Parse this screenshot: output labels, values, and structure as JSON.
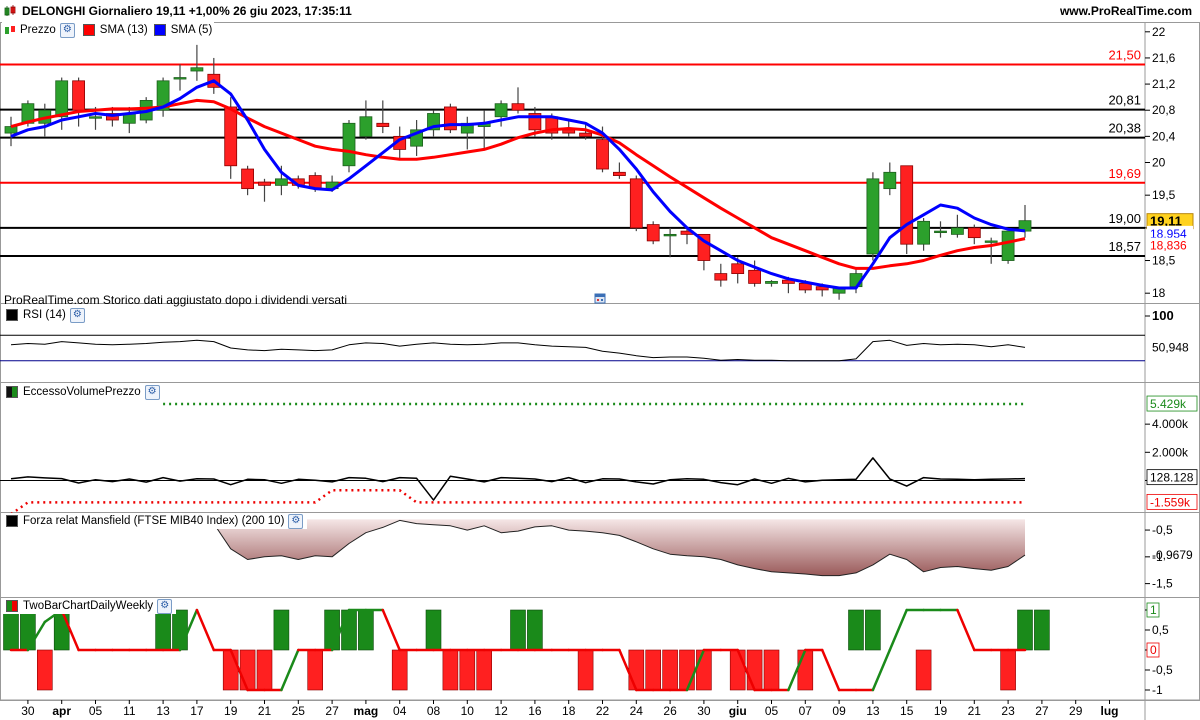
{
  "header": {
    "title": "DELONGHI Giornaliero 19,11 +1,00% 26 giu 2023, 17:35:11",
    "site": "www.ProRealTime.com"
  },
  "legends": {
    "price": [
      {
        "label": "Prezzo",
        "color": "#2ca02c"
      },
      {
        "label": "SMA (13)",
        "color": "#ff0000"
      },
      {
        "label": "SMA (5)",
        "color": "#0000ff"
      }
    ],
    "rsi": "RSI (14)",
    "eccesso": "EccessoVolumePrezzo",
    "forza": "Forza relat Mansfield (FTSE MIB40 Index) (200 10)",
    "twobar": "TwoBarChartDailyWeekly"
  },
  "note": "ProRealTime.com  Storico dati aggiustato dopo i dividendi versati",
  "chart_data": {
    "type": "candlestick",
    "x": [
      "29 mar",
      "30 mar",
      "31 mar",
      "03 apr",
      "04 apr",
      "05 apr",
      "06 apr",
      "11 apr",
      "12 apr",
      "13 apr",
      "14 apr",
      "17 apr",
      "18 apr",
      "19 apr",
      "20 apr",
      "21 apr",
      "24 apr",
      "25 apr",
      "26 apr",
      "27 apr",
      "28 apr",
      "02 mag",
      "03 mag",
      "04 mag",
      "05 mag",
      "08 mag",
      "09 mag",
      "10 mag",
      "11 mag",
      "12 mag",
      "15 mag",
      "16 mag",
      "17 mag",
      "18 mag",
      "19 mag",
      "22 mag",
      "23 mag",
      "24 mag",
      "25 mag",
      "26 mag",
      "29 mag",
      "30 mag",
      "31 mag",
      "01 giu",
      "02 giu",
      "05 giu",
      "06 giu",
      "07 giu",
      "08 giu",
      "09 giu",
      "12 giu",
      "13 giu",
      "14 giu",
      "15 giu",
      "16 giu",
      "19 giu",
      "20 giu",
      "21 giu",
      "22 giu",
      "23 giu",
      "26 giu"
    ],
    "x_ticks": [
      "30",
      "apr",
      "05",
      "11",
      "13",
      "17",
      "19",
      "21",
      "25",
      "27",
      "mag",
      "04",
      "08",
      "10",
      "12",
      "16",
      "18",
      "22",
      "24",
      "26",
      "30",
      "giu",
      "05",
      "07",
      "09",
      "13",
      "15",
      "19",
      "21",
      "23",
      "27",
      "29",
      "lug"
    ],
    "price": {
      "ylim": [
        17.85,
        22.15
      ],
      "y_ticks": [
        "22",
        "21,6",
        "21,2",
        "20,8",
        "20,4",
        "20",
        "19,5",
        "19",
        "18,5",
        "18"
      ],
      "ohlc": [
        [
          20.45,
          20.7,
          20.25,
          20.55
        ],
        [
          20.6,
          20.95,
          20.55,
          20.9
        ],
        [
          20.6,
          20.9,
          20.4,
          20.8
        ],
        [
          20.7,
          21.3,
          20.5,
          21.25
        ],
        [
          21.25,
          21.3,
          20.55,
          20.8
        ],
        [
          20.7,
          20.85,
          20.5,
          20.7
        ],
        [
          20.75,
          20.85,
          20.55,
          20.65
        ],
        [
          20.6,
          20.85,
          20.45,
          20.75
        ],
        [
          20.65,
          21.0,
          20.6,
          20.95
        ],
        [
          20.8,
          21.3,
          20.7,
          21.25
        ],
        [
          21.3,
          21.5,
          21.1,
          21.3
        ],
        [
          21.4,
          21.8,
          21.25,
          21.45
        ],
        [
          21.35,
          21.6,
          21.05,
          21.15
        ],
        [
          20.85,
          21.0,
          19.75,
          19.95
        ],
        [
          19.9,
          19.95,
          19.5,
          19.6
        ],
        [
          19.7,
          19.75,
          19.4,
          19.65
        ],
        [
          19.65,
          19.95,
          19.5,
          19.75
        ],
        [
          19.75,
          19.8,
          19.6,
          19.65
        ],
        [
          19.8,
          19.85,
          19.55,
          19.6
        ],
        [
          19.6,
          19.8,
          19.55,
          19.7
        ],
        [
          19.95,
          20.65,
          19.85,
          20.6
        ],
        [
          20.4,
          20.95,
          20.35,
          20.7
        ],
        [
          20.6,
          20.95,
          20.45,
          20.55
        ],
        [
          20.4,
          20.55,
          20.05,
          20.2
        ],
        [
          20.25,
          20.65,
          20.1,
          20.5
        ],
        [
          20.5,
          20.8,
          20.4,
          20.75
        ],
        [
          20.85,
          20.9,
          20.45,
          20.5
        ],
        [
          20.45,
          20.7,
          20.2,
          20.6
        ],
        [
          20.55,
          20.8,
          20.2,
          20.6
        ],
        [
          20.7,
          20.95,
          20.55,
          20.9
        ],
        [
          20.9,
          21.15,
          20.75,
          20.8
        ],
        [
          20.75,
          20.85,
          20.4,
          20.5
        ],
        [
          20.7,
          20.75,
          20.35,
          20.45
        ],
        [
          20.5,
          20.65,
          20.4,
          20.45
        ],
        [
          20.45,
          20.6,
          20.35,
          20.4
        ],
        [
          20.35,
          20.55,
          19.85,
          19.9
        ],
        [
          19.85,
          20.0,
          19.75,
          19.8
        ],
        [
          19.75,
          19.8,
          18.95,
          19.0
        ],
        [
          19.05,
          19.1,
          18.75,
          18.8
        ],
        [
          18.9,
          19.0,
          18.55,
          18.9
        ],
        [
          18.95,
          19.0,
          18.75,
          18.9
        ],
        [
          18.9,
          18.9,
          18.35,
          18.5
        ],
        [
          18.3,
          18.45,
          18.1,
          18.2
        ],
        [
          18.45,
          18.55,
          18.15,
          18.3
        ],
        [
          18.35,
          18.5,
          18.1,
          18.15
        ],
        [
          18.15,
          18.2,
          18.1,
          18.18
        ],
        [
          18.2,
          18.25,
          18.0,
          18.15
        ],
        [
          18.15,
          18.2,
          18.0,
          18.05
        ],
        [
          18.1,
          18.15,
          17.95,
          18.05
        ],
        [
          18.0,
          18.1,
          17.9,
          18.08
        ],
        [
          18.1,
          18.4,
          18.0,
          18.3
        ],
        [
          18.6,
          19.85,
          18.5,
          19.75
        ],
        [
          19.6,
          20.0,
          19.5,
          19.85
        ],
        [
          19.95,
          19.95,
          18.6,
          18.75
        ],
        [
          18.75,
          19.15,
          18.65,
          19.1
        ],
        [
          18.95,
          19.1,
          18.85,
          18.95
        ],
        [
          18.9,
          19.2,
          18.85,
          19.0
        ],
        [
          19.0,
          19.05,
          18.75,
          18.85
        ],
        [
          18.8,
          18.85,
          18.45,
          18.8
        ],
        [
          18.5,
          18.95,
          18.45,
          18.95
        ],
        [
          18.95,
          19.35,
          18.85,
          19.11
        ]
      ],
      "sma13": [
        20.55,
        20.62,
        20.68,
        20.73,
        20.78,
        20.8,
        20.82,
        20.82,
        20.83,
        20.85,
        20.9,
        20.95,
        20.93,
        20.82,
        20.68,
        20.55,
        20.45,
        20.35,
        20.25,
        20.2,
        20.17,
        20.12,
        20.08,
        20.05,
        20.05,
        20.08,
        20.12,
        20.16,
        20.2,
        20.28,
        20.38,
        20.45,
        20.5,
        20.52,
        20.5,
        20.42,
        20.3,
        20.12,
        19.95,
        19.78,
        19.62,
        19.46,
        19.3,
        19.15,
        19.0,
        18.85,
        18.75,
        18.65,
        18.55,
        18.45,
        18.38,
        18.38,
        18.42,
        18.45,
        18.5,
        18.58,
        18.65,
        18.7,
        18.73,
        18.78,
        18.836
      ],
      "sma5": [
        20.4,
        20.5,
        20.55,
        20.65,
        20.7,
        20.75,
        20.72,
        20.75,
        20.78,
        20.85,
        20.98,
        21.15,
        21.25,
        21.05,
        20.65,
        20.2,
        19.85,
        19.65,
        19.6,
        19.58,
        19.75,
        19.95,
        20.15,
        20.35,
        20.45,
        20.55,
        20.58,
        20.58,
        20.6,
        20.65,
        20.7,
        20.7,
        20.7,
        20.65,
        20.6,
        20.45,
        20.2,
        19.9,
        19.55,
        19.25,
        19.0,
        18.8,
        18.65,
        18.5,
        18.4,
        18.3,
        18.22,
        18.17,
        18.12,
        18.08,
        18.08,
        18.45,
        18.85,
        19.05,
        19.2,
        19.35,
        19.3,
        19.15,
        19.05,
        18.98,
        18.954
      ],
      "hlines": [
        {
          "value": 21.5,
          "label": "21,50",
          "color": "#ff0000"
        },
        {
          "value": 20.81,
          "label": "20,81",
          "color": "#000000"
        },
        {
          "value": 20.38,
          "label": "20,38",
          "color": "#000000"
        },
        {
          "value": 19.69,
          "label": "19,69",
          "color": "#ff0000"
        },
        {
          "value": 19.0,
          "label": "19,00",
          "color": "#000000"
        },
        {
          "value": 18.57,
          "label": "18,57",
          "color": "#000000"
        }
      ],
      "last_labels": [
        {
          "value": 19.11,
          "label": "19,11",
          "bg": "#ffd21f",
          "fg": "#000000",
          "bold": true
        },
        {
          "value": 18.954,
          "label": "18,954",
          "bg": "#ffffff",
          "fg": "#0000ff",
          "bold": false
        },
        {
          "value": 18.836,
          "label": "18,836",
          "bg": "#ffffff",
          "fg": "#ff0000",
          "bold": false
        }
      ]
    },
    "rsi": {
      "ylim": [
        0,
        100
      ],
      "y_ticks": [
        "100"
      ],
      "levels": [
        70,
        30
      ],
      "last_label": "50,948",
      "values": [
        55,
        57,
        56,
        60,
        58,
        56,
        55,
        56,
        57,
        59,
        60,
        62,
        60,
        50,
        47,
        46,
        48,
        47,
        46,
        47,
        55,
        58,
        57,
        53,
        56,
        58,
        56,
        55,
        56,
        58,
        58,
        55,
        53,
        52,
        51,
        45,
        42,
        38,
        35,
        36,
        36,
        34,
        31,
        32,
        31,
        31,
        30,
        30,
        30,
        30,
        33,
        60,
        62,
        54,
        57,
        55,
        56,
        55,
        52,
        55,
        50.948
      ]
    },
    "eccesso": {
      "ylim": [
        -2100,
        6000
      ],
      "y_ticks": [
        "4.000k",
        "2.000k",
        "0"
      ],
      "upper_level": 5429,
      "lower_level": -1559,
      "upper_label": "5.429k",
      "lower_label": "-1.559k",
      "last_label": "128.128",
      "values": [
        120,
        250,
        180,
        130,
        -180,
        50,
        -80,
        100,
        -120,
        200,
        -50,
        120,
        100,
        -300,
        80,
        50,
        -200,
        80,
        20,
        -100,
        200,
        150,
        -80,
        200,
        150,
        -1400,
        300,
        100,
        -100,
        200,
        150,
        100,
        -80,
        200,
        -150,
        120,
        100,
        -100,
        -250,
        50,
        120,
        80,
        -150,
        -300,
        100,
        -200,
        150,
        -100,
        20,
        50,
        80,
        1600,
        100,
        -400,
        200,
        100,
        80,
        50,
        80,
        100,
        128
      ]
    },
    "forza": {
      "ylim": [
        -1.75,
        -0.2
      ],
      "y_ticks": [
        "-0,5",
        "-1",
        "-1,5"
      ],
      "last_label": "-0,9679",
      "values": [
        -0.38,
        -0.33,
        -0.43,
        -0.4,
        -0.38,
        -0.37,
        -0.4,
        -0.38,
        -0.36,
        -0.34,
        -0.32,
        -0.3,
        -0.38,
        -0.85,
        -1.05,
        -1.0,
        -0.98,
        -1.05,
        -0.98,
        -1.0,
        -0.75,
        -0.55,
        -0.45,
        -0.32,
        -0.38,
        -0.4,
        -0.42,
        -0.5,
        -0.42,
        -0.55,
        -0.52,
        -0.44,
        -0.42,
        -0.5,
        -0.52,
        -0.55,
        -0.6,
        -0.72,
        -0.85,
        -0.95,
        -0.98,
        -1.0,
        -1.05,
        -1.15,
        -1.22,
        -1.28,
        -1.3,
        -1.32,
        -1.35,
        -1.35,
        -1.3,
        -1.15,
        -0.95,
        -1.05,
        -1.28,
        -1.2,
        -1.18,
        -1.22,
        -1.25,
        -1.18,
        -0.9679
      ]
    },
    "twobar": {
      "ylim": [
        -1.25,
        1.25
      ],
      "y_ticks": [
        "1",
        "0,5",
        "0",
        "-0,5",
        "-1"
      ],
      "last_label": "1",
      "zero_label": "0",
      "bars": [
        1,
        1,
        -1,
        1,
        0,
        0,
        0,
        0,
        0,
        1,
        1,
        0,
        0,
        -1,
        -1,
        -1,
        1,
        0,
        -1,
        1,
        1,
        1,
        0,
        -1,
        0,
        1,
        -1,
        -1,
        -1,
        0,
        1,
        1,
        0,
        0,
        -1,
        0,
        0,
        -1,
        -1,
        -1,
        -1,
        -1,
        0,
        -1,
        -1,
        -1,
        0,
        -1,
        0,
        0,
        1,
        1,
        0,
        0,
        -1,
        0,
        0,
        0,
        0,
        -1,
        1,
        1
      ],
      "line": [
        0,
        0,
        0.7,
        1,
        0,
        0,
        0,
        0,
        0,
        0,
        0,
        1,
        0,
        0,
        -1,
        -1,
        -1,
        0,
        0,
        0,
        1,
        1,
        1,
        0,
        0,
        0,
        0,
        0,
        0,
        0,
        0,
        0,
        0,
        0,
        0,
        0,
        0,
        -1,
        -1,
        -1,
        -1,
        0,
        0,
        0,
        -1,
        -1,
        -1,
        0,
        0,
        -1,
        -1,
        -1,
        0,
        1,
        1,
        1,
        1,
        0,
        0,
        0,
        0
      ]
    }
  }
}
